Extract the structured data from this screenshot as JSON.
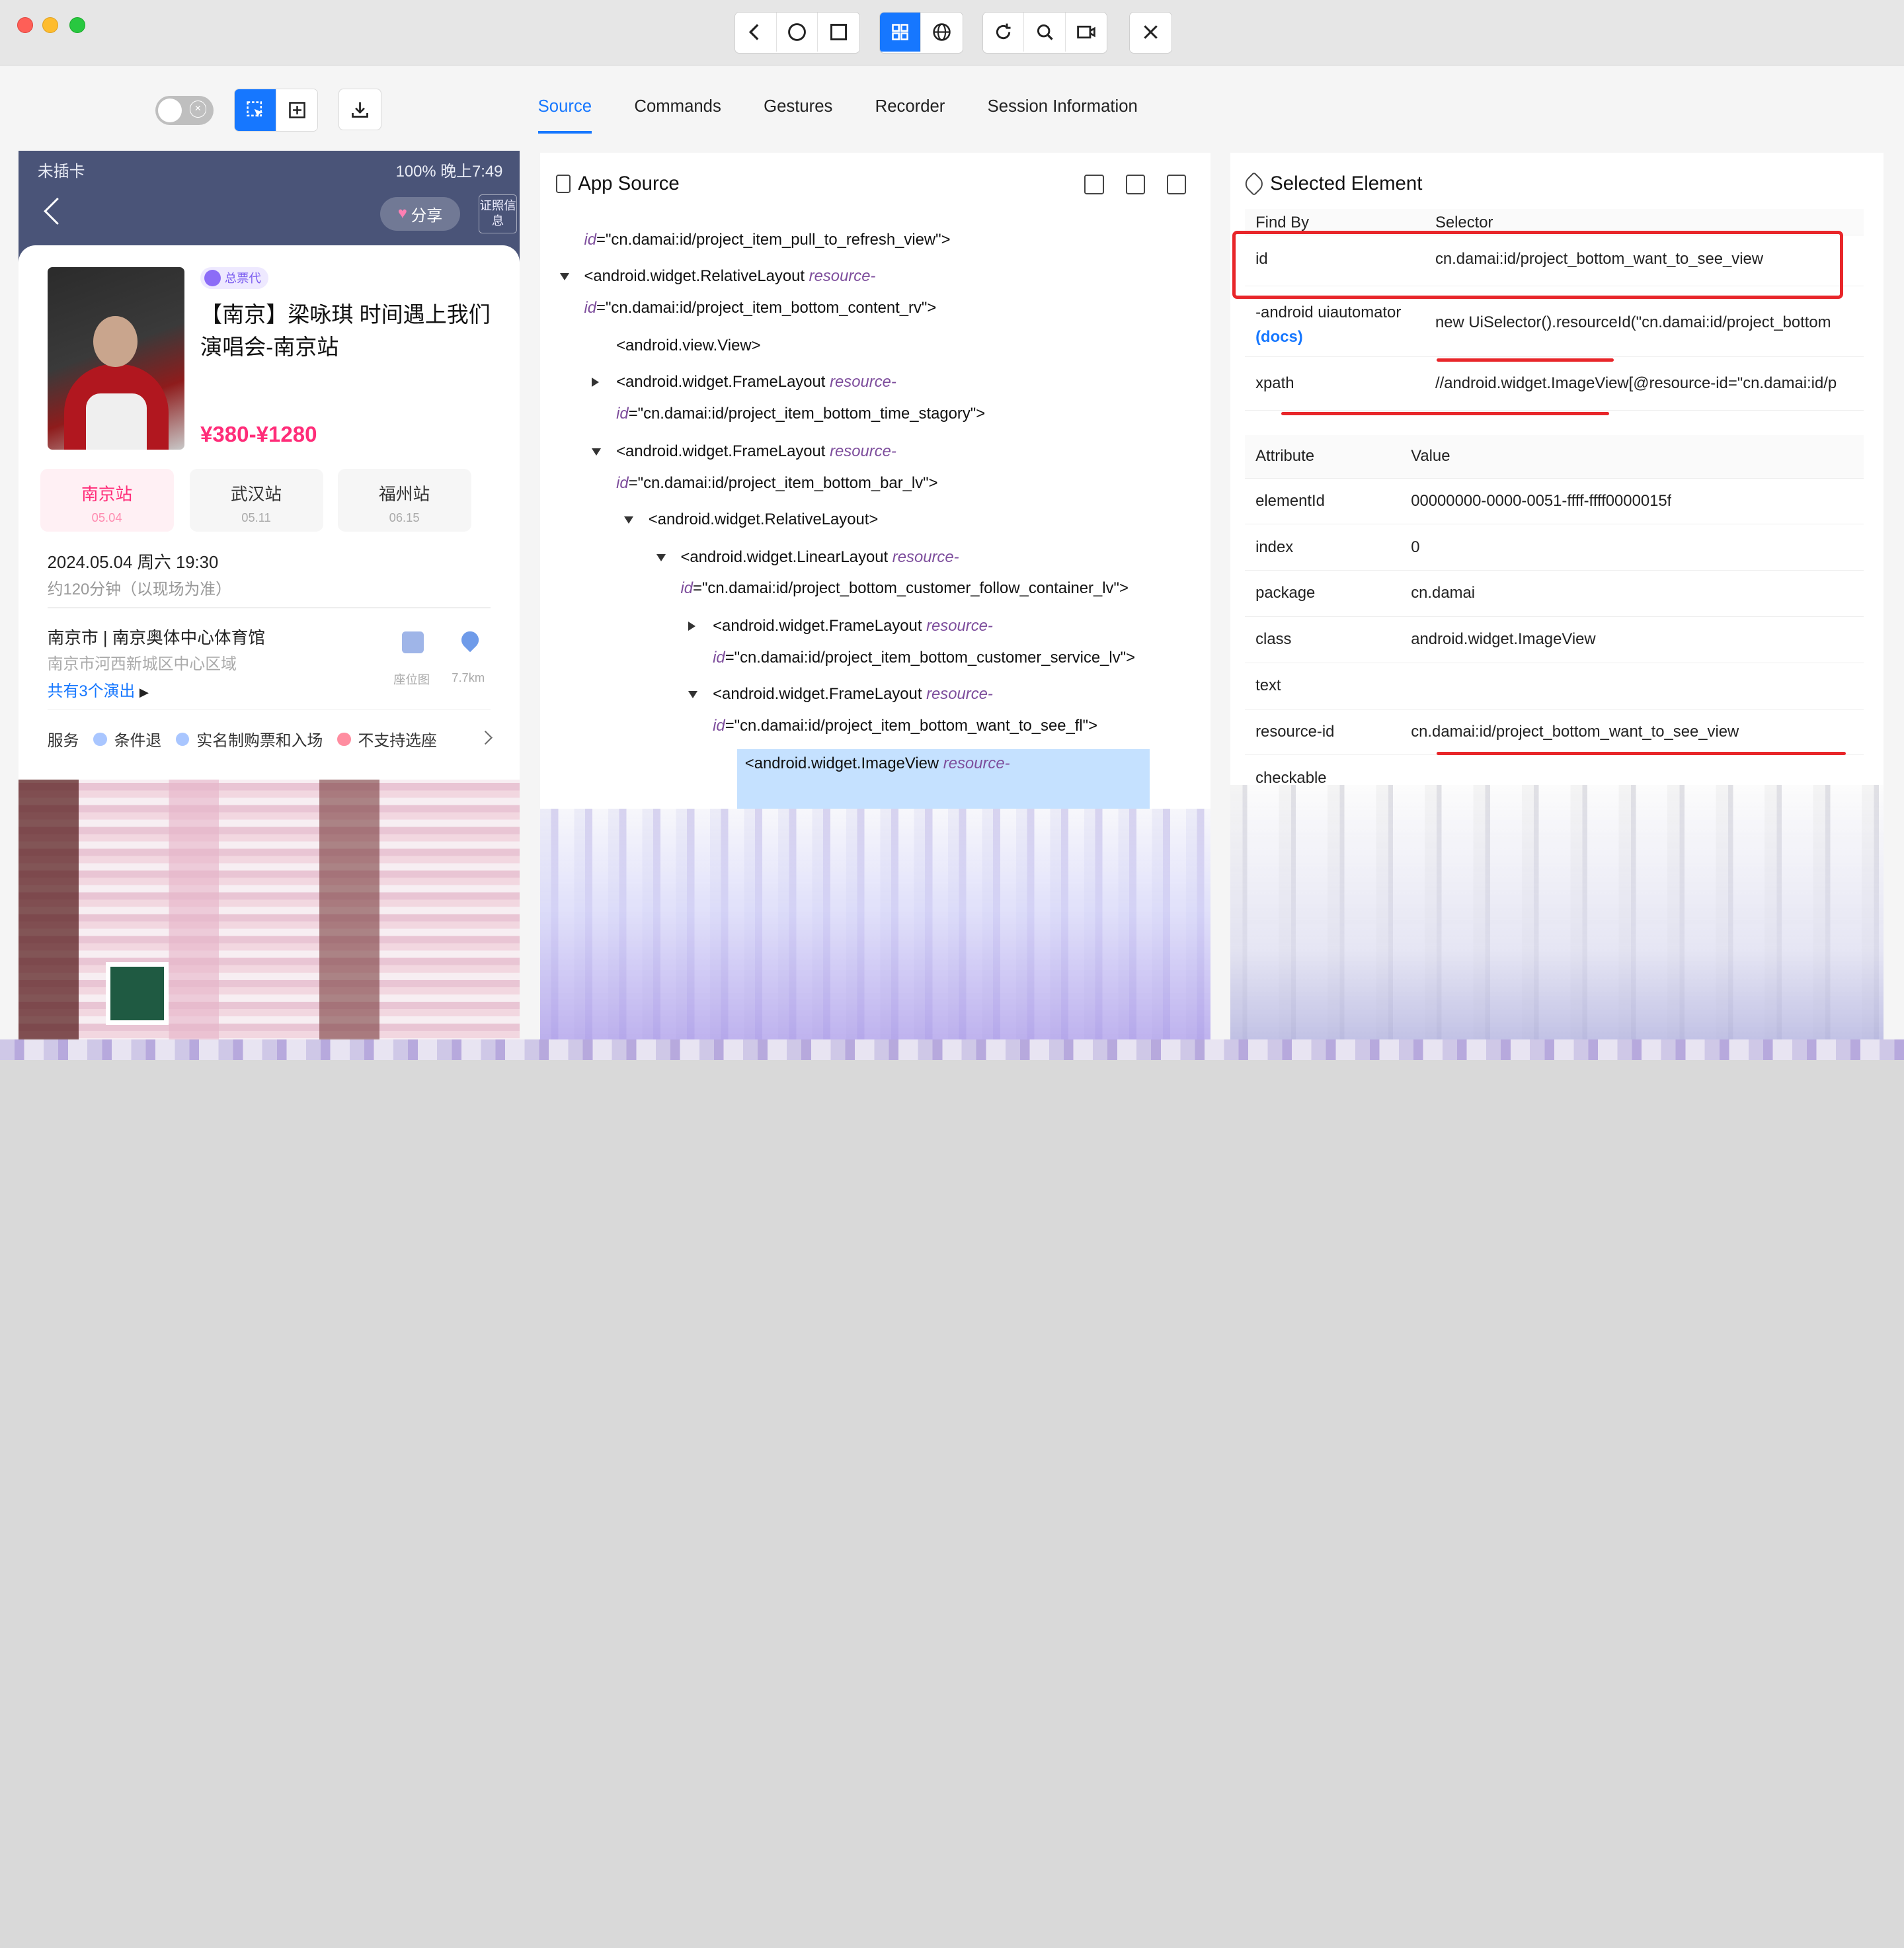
{
  "window": {
    "toolbar_buttons": [
      "back-icon",
      "home-icon",
      "app-switch-icon",
      "grid-icon",
      "globe-icon",
      "refresh-icon",
      "search-icon",
      "record-icon",
      "close-icon"
    ]
  },
  "tabs": [
    {
      "label": "Source",
      "active": true
    },
    {
      "label": "Commands",
      "active": false
    },
    {
      "label": "Gestures",
      "active": false
    },
    {
      "label": "Recorder",
      "active": false
    },
    {
      "label": "Session Information",
      "active": false
    }
  ],
  "phone": {
    "status_left": "未插卡",
    "status_right": "100%  晚上7:49",
    "share_label": "分享",
    "cert_label": "证照信息",
    "agent_badge": "总票代",
    "show_title": "【南京】梁咏琪 时间遇上我们 演唱会-南京站",
    "price": "¥380-¥1280",
    "stations": [
      {
        "name": "南京站",
        "date": "05.04",
        "selected": true
      },
      {
        "name": "武汉站",
        "date": "05.11",
        "selected": false
      },
      {
        "name": "福州站",
        "date": "06.15",
        "selected": false
      }
    ],
    "date_line": "2024.05.04 周六 19:30",
    "duration": "约120分钟（以现场为准）",
    "venue": "南京市 | 南京奥体中心体育馆",
    "address": "南京市河西新城区中心区域",
    "more_shows": "共有3个演出",
    "seat_label": "座位图",
    "distance": "7.7km",
    "services_label": "服务",
    "services": [
      {
        "label": "条件退",
        "kind": "blue"
      },
      {
        "label": "实名制购票和入场",
        "kind": "blue"
      },
      {
        "label": "不支持选座",
        "kind": "pink"
      }
    ]
  },
  "app_source": {
    "title": "App Source",
    "lines": [
      {
        "indent": 0,
        "caret": "none",
        "prefix": "",
        "attr": "id",
        "val": "=\"cn.damai:id/project_item_pull_to_refresh_view\">"
      },
      {
        "indent": 0,
        "caret": "down",
        "prefix": "<android.widget.RelativeLayout ",
        "attr": "resource-",
        "val": ""
      },
      {
        "indent": 0,
        "caret": "none",
        "prefix": "",
        "attr": "id",
        "val": "=\"cn.damai:id/project_item_bottom_content_rv\">"
      },
      {
        "indent": 1,
        "caret": "none",
        "prefix": "<android.view.View>",
        "attr": "",
        "val": ""
      },
      {
        "indent": 1,
        "caret": "right",
        "prefix": "<android.widget.FrameLayout ",
        "attr": "resource-",
        "val": ""
      },
      {
        "indent": 1,
        "caret": "none",
        "prefix": "",
        "attr": "id",
        "val": "=\"cn.damai:id/project_item_bottom_time_stagory\">"
      },
      {
        "indent": 1,
        "caret": "down",
        "prefix": "<android.widget.FrameLayout ",
        "attr": "resource-",
        "val": ""
      },
      {
        "indent": 1,
        "caret": "none",
        "prefix": "",
        "attr": "id",
        "val": "=\"cn.damai:id/project_item_bottom_bar_lv\">"
      },
      {
        "indent": 2,
        "caret": "down",
        "prefix": "<android.widget.RelativeLayout>",
        "attr": "",
        "val": ""
      },
      {
        "indent": 3,
        "caret": "down",
        "prefix": "<android.widget.LinearLayout ",
        "attr": "resource-",
        "val": ""
      },
      {
        "indent": 3,
        "caret": "none",
        "prefix": "",
        "attr": "id",
        "val": "=\"cn.damai:id/project_bottom_customer_follow_container_lv\">"
      },
      {
        "indent": 4,
        "caret": "right",
        "prefix": "<android.widget.FrameLayout ",
        "attr": "resource-",
        "val": ""
      },
      {
        "indent": 4,
        "caret": "none",
        "prefix": "",
        "attr": "id",
        "val": "=\"cn.damai:id/project_item_bottom_customer_service_lv\">"
      },
      {
        "indent": 4,
        "caret": "down",
        "prefix": "<android.widget.FrameLayout ",
        "attr": "resource-",
        "val": ""
      },
      {
        "indent": 4,
        "caret": "none",
        "prefix": "",
        "attr": "id",
        "val": "=\"cn.damai:id/project_item_bottom_want_to_see_fl\">"
      },
      {
        "indent": 5,
        "caret": "none",
        "prefix": "<android.widget.ImageView ",
        "attr": "resource-",
        "val": ""
      }
    ]
  },
  "selected_element": {
    "title": "Selected Element",
    "find_by_header": "Find By",
    "selector_header": "Selector",
    "selectors": [
      {
        "by": "id",
        "value": "cn.damai:id/project_bottom_want_to_see_view"
      },
      {
        "by": "-android uiautomator",
        "docs": "(docs)",
        "value": "new UiSelector().resourceId(\"cn.damai:id/project_bottom"
      },
      {
        "by": "xpath",
        "value": "//android.widget.ImageView[@resource-id=\"cn.damai:id/p"
      }
    ],
    "attr_header": "Attribute",
    "value_header": "Value",
    "attributes": [
      {
        "name": "elementId",
        "value": "00000000-0000-0051-ffff-ffff0000015f"
      },
      {
        "name": "index",
        "value": "0"
      },
      {
        "name": "package",
        "value": "cn.damai"
      },
      {
        "name": "class",
        "value": "android.widget.ImageView"
      },
      {
        "name": "text",
        "value": ""
      },
      {
        "name": "resource-id",
        "value": "cn.damai:id/project_bottom_want_to_see_view"
      },
      {
        "name": "checkable",
        "value": ""
      }
    ],
    "highlight_color": "#e8262a"
  }
}
